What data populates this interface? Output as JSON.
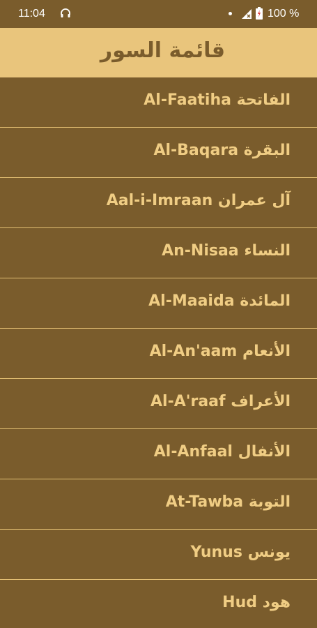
{
  "status_bar": {
    "time": "11:04",
    "battery": "100 %"
  },
  "header": {
    "title": "قائمة السور"
  },
  "surahs": [
    {
      "label": "Al-Faatiha الفاتحة"
    },
    {
      "label": "Al-Baqara البقرة"
    },
    {
      "label": "Aal-i-Imraan آل عمران"
    },
    {
      "label": "An-Nisaa النساء"
    },
    {
      "label": "Al-Maaida المائدة"
    },
    {
      "label": "Al-An'aam الأنعام"
    },
    {
      "label": "Al-A'raaf الأعراف"
    },
    {
      "label": "Al-Anfaal الأنفال"
    },
    {
      "label": "At-Tawba التوبة"
    },
    {
      "label": "Yunus يونس"
    },
    {
      "label": "Hud هود"
    }
  ],
  "colors": {
    "background": "#7a5c2c",
    "header": "#e9c57c",
    "text": "#f0cd84",
    "divider": "#e3bf73"
  }
}
